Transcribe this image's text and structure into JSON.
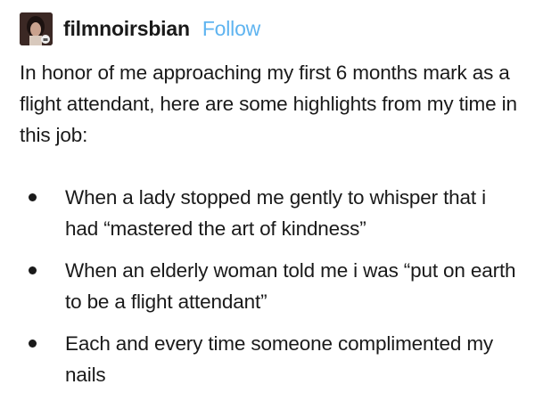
{
  "post": {
    "username": "filmnoirsbian",
    "follow_label": "Follow",
    "intro": "In honor of me approaching my first 6 months mark as a flight attendant, here are some highlights from my time in this job:",
    "bullets": [
      "When a lady stopped me gently to whisper that i had “mastered the art of kindness”",
      "When an elderly woman told me i was “put on earth to be a flight attendant”",
      "Each and every time someone complimented my nails"
    ]
  },
  "colors": {
    "follow": "#5fb4f0",
    "text": "#1a1a1a"
  },
  "icons": {
    "avatar": "user-avatar-icon"
  }
}
